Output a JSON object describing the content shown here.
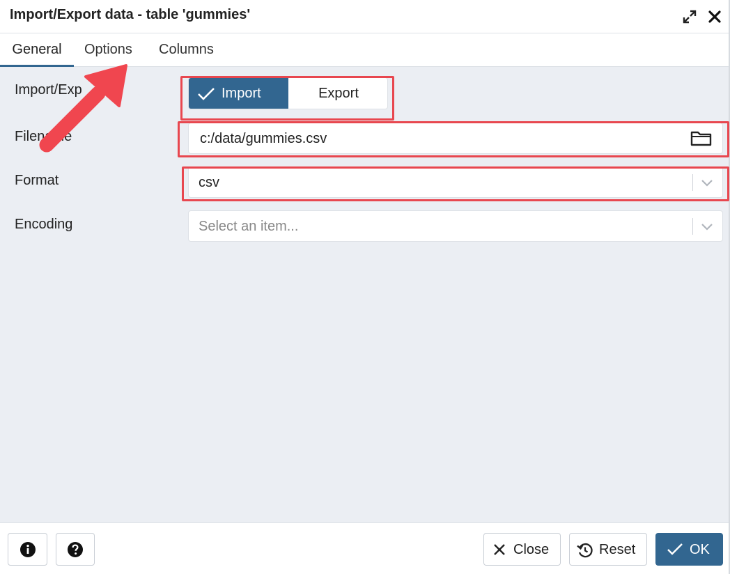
{
  "dialog": {
    "title": "Import/Export data - table 'gummies'",
    "expand_icon": "expand-icon",
    "close_icon": "close-icon"
  },
  "tabs": [
    {
      "label": "General",
      "active": true
    },
    {
      "label": "Options",
      "active": false
    },
    {
      "label": "Columns",
      "active": false
    }
  ],
  "form": {
    "import_export": {
      "label": "Import/Exp",
      "options": [
        "Import",
        "Export"
      ],
      "selected": "Import"
    },
    "filename": {
      "label": "Filename",
      "value": "c:/data/gummies.csv",
      "icon": "folder-icon"
    },
    "format": {
      "label": "Format",
      "value": "csv"
    },
    "encoding": {
      "label": "Encoding",
      "placeholder": "Select an item..."
    }
  },
  "footer": {
    "info_icon": "info-icon",
    "help_icon": "help-icon",
    "close_label": "Close",
    "reset_label": "Reset",
    "ok_label": "OK"
  },
  "colors": {
    "accent": "#326690",
    "annotation": "#e8474f",
    "panel_bg": "#ebeef3"
  }
}
